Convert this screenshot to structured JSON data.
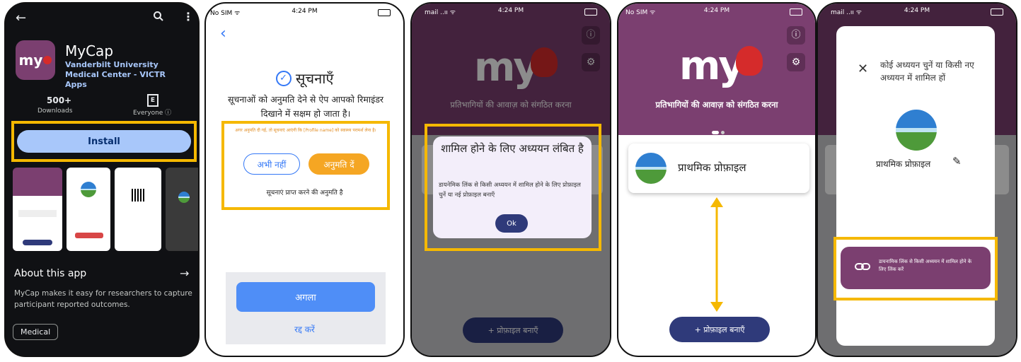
{
  "p1": {
    "app_name": "MyCap",
    "developer": "Vanderbilt University Medical Center - VICTR Apps",
    "icon_text": "my",
    "downloads_value": "500+",
    "downloads_label": "Downloads",
    "rating_label": "Everyone ⓘ",
    "install": "Install",
    "about_title": "About this app",
    "about_text": "MyCap makes it easy for researchers to capture participant reported outcomes.",
    "category": "Medical"
  },
  "p2": {
    "title": "सूचनाएँ",
    "desc": "सूचनाओं को अनुमति देने से ऐप आपको रिमाइंडर दिखाने में सक्षम हो जाता है।",
    "notice": "अगर अनुमति दी गई, तो सूचनाएं आएंगी कि [Profile name] को स्वास्थ्य परामर्श लेना है।",
    "not_now": "अभी नहीं",
    "allow": "अनुमति दें",
    "receive_label": "सूचनाएं प्राप्त करने की अनुमति है",
    "next": "अगला",
    "cancel": "रद्द करें"
  },
  "p3": {
    "time": "4:24 PM",
    "carrier": "mail ..ıı ᯤ",
    "tagline": "प्रतिभागियों की आवाज़ को संगठित करना",
    "dialog_title": "शामिल होने के लिए अध्ययन लंबित है",
    "dialog_body": "डायनेमिक लिंक से किसी अध्ययन में शामिल होने के लिए प्रोफ़ाइल चुनें या नई प्रोफ़ाइल बनाएँ",
    "ok": "Ok",
    "create_profile": "+  प्रोफ़ाइल बनाएँ"
  },
  "p4": {
    "carrier": "No SIM ᯤ",
    "time": "4:24 PM",
    "logo": "my",
    "tagline": "प्रतिभागियों की आवाज़ को संगठित करना",
    "profile": "प्राथमिक प्रोफ़ाइल",
    "create_profile": "+  प्रोफ़ाइल बनाएँ"
  },
  "p5": {
    "carrier": "mail ..ıı ᯤ",
    "time": "4:24 PM",
    "title": "कोई अध्ययन चुनें या किसी नए अध्ययन में शामिल हों",
    "profile": "प्राथमिक प्रोफ़ाइल",
    "link_button": "डायनामिक लिंक से किसी अध्ययन में शामिल होने के लिए लिंक करें"
  },
  "status": {
    "time": "4:24 PM",
    "carrier": "No SIM ᯤ"
  },
  "colors": {
    "highlight": "#f5b800",
    "brand_purple": "#7b3f70",
    "install_blue": "#a8c7fa",
    "orange": "#f5a623",
    "blue_btn": "#4f8ef7",
    "navy": "#2f3a7a"
  }
}
